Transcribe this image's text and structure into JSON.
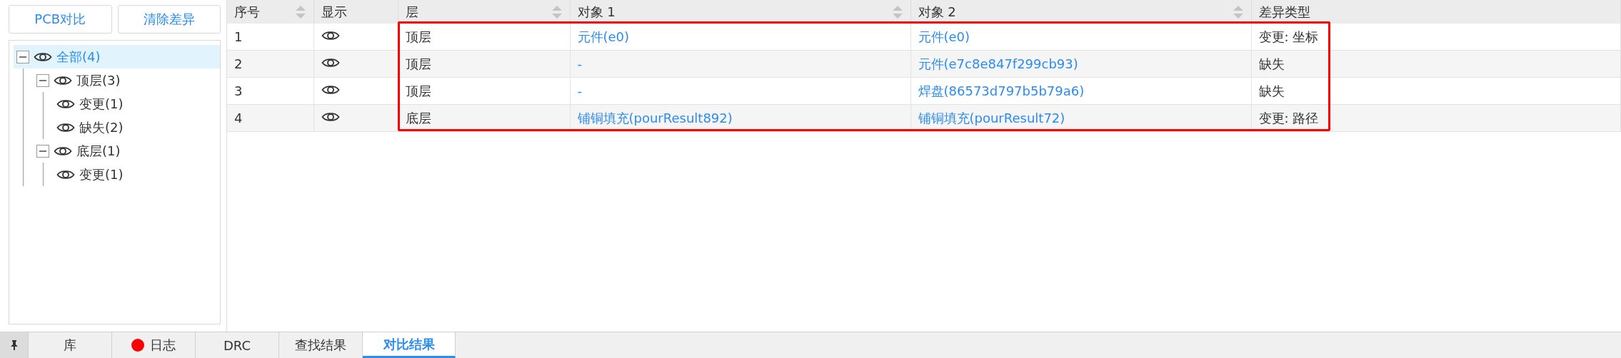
{
  "sidebar": {
    "buttons": [
      "PCB对比",
      "清除差异"
    ],
    "tree": [
      {
        "label": "全部(4)",
        "selected": true,
        "expanded": true,
        "children": [
          {
            "label": "顶层(3)",
            "selected": false,
            "expanded": true,
            "children": [
              {
                "label": "变更(1)",
                "selected": false
              },
              {
                "label": "缺失(2)",
                "selected": false
              }
            ]
          },
          {
            "label": "底层(1)",
            "selected": false,
            "expanded": true,
            "children": [
              {
                "label": "变更(1)",
                "selected": false
              }
            ]
          }
        ]
      }
    ]
  },
  "table": {
    "columns": [
      {
        "label": "序号",
        "sortable": true,
        "kind": "text"
      },
      {
        "label": "显示",
        "sortable": false,
        "kind": "eye"
      },
      {
        "label": "层",
        "sortable": true,
        "kind": "text"
      },
      {
        "label": "对象 1",
        "sortable": true,
        "kind": "link"
      },
      {
        "label": "对象 2",
        "sortable": true,
        "kind": "link"
      },
      {
        "label": "差异类型",
        "sortable": false,
        "kind": "text"
      }
    ],
    "rows": [
      [
        "1",
        "",
        "顶层",
        "元件(e0)",
        "元件(e0)",
        "变更: 坐标"
      ],
      [
        "2",
        "",
        "顶层",
        "-",
        "元件(e7c8e847f299cb93)",
        "缺失"
      ],
      [
        "3",
        "",
        "顶层",
        "-",
        "焊盘(86573d797b5b79a6)",
        "缺失"
      ],
      [
        "4",
        "",
        "底层",
        "铺铜填充(pourResult892)",
        "铺铜填充(pourResult72)",
        "变更: 路径"
      ]
    ]
  },
  "bottom_tabs": [
    {
      "kind": "pin",
      "selected": false
    },
    {
      "kind": "text",
      "label": "库",
      "selected": false
    },
    {
      "kind": "dot",
      "label": "日志",
      "selected": false,
      "color": "#ff0000"
    },
    {
      "kind": "text",
      "label": "DRC",
      "selected": false
    },
    {
      "kind": "text",
      "label": "查找结果",
      "selected": false
    },
    {
      "kind": "text",
      "label": "对比结果",
      "selected": true
    }
  ]
}
